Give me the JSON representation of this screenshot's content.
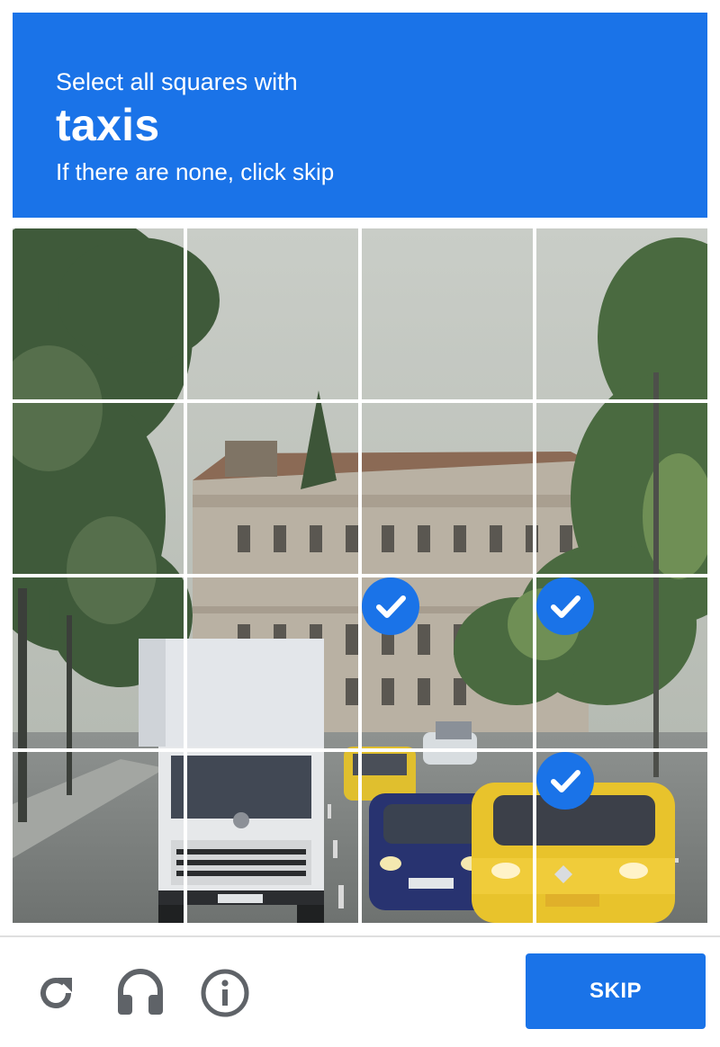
{
  "header": {
    "instruction": "Select all squares with",
    "keyword": "taxis",
    "subinstruction": "If there are none, click skip"
  },
  "grid": {
    "rows": 4,
    "cols": 4,
    "selected_tiles": [
      [
        2,
        2
      ],
      [
        2,
        3
      ],
      [
        3,
        3
      ]
    ]
  },
  "footer": {
    "reload_icon": "reload-icon",
    "audio_icon": "headphones-icon",
    "info_icon": "info-icon",
    "skip_label": "SKIP"
  },
  "colors": {
    "brand_blue": "#1a73e8",
    "icon_gray": "#5f6368"
  }
}
